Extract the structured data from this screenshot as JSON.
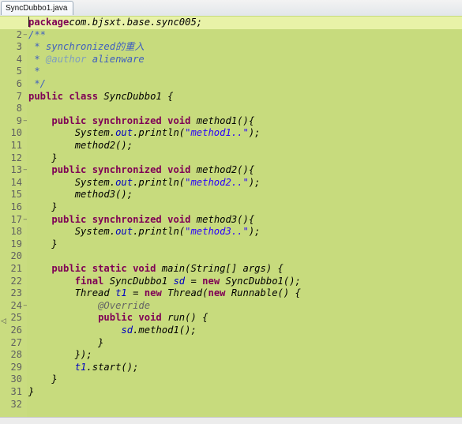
{
  "tab": {
    "title": "SyncDubbo1.java"
  },
  "line_numbers": [
    "1",
    "2",
    "3",
    "4",
    "5",
    "6",
    "7",
    "8",
    "9",
    "10",
    "11",
    "12",
    "13",
    "14",
    "15",
    "16",
    "17",
    "18",
    "19",
    "20",
    "21",
    "22",
    "23",
    "24",
    "25",
    "26",
    "27",
    "28",
    "29",
    "30",
    "31",
    "32"
  ],
  "fold_markers": {
    "2": "−",
    "9": "−",
    "13": "−",
    "17": "−",
    "24": "−"
  },
  "gutter_marker": "◁",
  "code_lines": [
    [
      [
        "kw",
        "package"
      ],
      [
        "",
        "com.bjsxt.base.sync005;"
      ]
    ],
    [
      [
        "cm",
        "/**"
      ]
    ],
    [
      [
        "cm",
        " * synchronized的重入"
      ]
    ],
    [
      [
        "cm",
        " * "
      ],
      [
        "tag",
        "@author"
      ],
      [
        "cm",
        " alienware"
      ]
    ],
    [
      [
        "cm",
        " *"
      ]
    ],
    [
      [
        "cm",
        " */"
      ]
    ],
    [
      [
        "kw",
        "public class"
      ],
      [
        "",
        " SyncDubbo1 {"
      ]
    ],
    [
      [
        "",
        ""
      ]
    ],
    [
      [
        "",
        "    "
      ],
      [
        "kw",
        "public synchronized void"
      ],
      [
        "",
        " method1(){"
      ]
    ],
    [
      [
        "",
        "        System."
      ],
      [
        "fld",
        "out"
      ],
      [
        "",
        ".println("
      ],
      [
        "str",
        "\"method1..\""
      ],
      [
        "",
        ");"
      ]
    ],
    [
      [
        "",
        "        method2();"
      ]
    ],
    [
      [
        "",
        "    }"
      ]
    ],
    [
      [
        "",
        "    "
      ],
      [
        "kw",
        "public synchronized void"
      ],
      [
        "",
        " method2(){"
      ]
    ],
    [
      [
        "",
        "        System."
      ],
      [
        "fld",
        "out"
      ],
      [
        "",
        ".println("
      ],
      [
        "str",
        "\"method2..\""
      ],
      [
        "",
        ");"
      ]
    ],
    [
      [
        "",
        "        method3();"
      ]
    ],
    [
      [
        "",
        "    }"
      ]
    ],
    [
      [
        "",
        "    "
      ],
      [
        "kw",
        "public synchronized void"
      ],
      [
        "",
        " method3(){"
      ]
    ],
    [
      [
        "",
        "        System."
      ],
      [
        "fld",
        "out"
      ],
      [
        "",
        ".println("
      ],
      [
        "str",
        "\"method3..\""
      ],
      [
        "",
        ");"
      ]
    ],
    [
      [
        "",
        "    }"
      ]
    ],
    [
      [
        "",
        ""
      ]
    ],
    [
      [
        "",
        "    "
      ],
      [
        "kw",
        "public static void"
      ],
      [
        "",
        " main(String[] args) {"
      ]
    ],
    [
      [
        "",
        "        "
      ],
      [
        "kw",
        "final"
      ],
      [
        "",
        " SyncDubbo1 "
      ],
      [
        "fld",
        "sd"
      ],
      [
        "",
        " = "
      ],
      [
        "kw",
        "new"
      ],
      [
        "",
        " SyncDubbo1();"
      ]
    ],
    [
      [
        "",
        "        Thread "
      ],
      [
        "fld",
        "t1"
      ],
      [
        "",
        " = "
      ],
      [
        "kw",
        "new"
      ],
      [
        "",
        " Thread("
      ],
      [
        "kw",
        "new"
      ],
      [
        "",
        " Runnable() {"
      ]
    ],
    [
      [
        "",
        "            "
      ],
      [
        "ann",
        "@Override"
      ]
    ],
    [
      [
        "",
        "            "
      ],
      [
        "kw",
        "public void"
      ],
      [
        "",
        " run() {"
      ]
    ],
    [
      [
        "",
        "                "
      ],
      [
        "fld",
        "sd"
      ],
      [
        "",
        ".method1();"
      ]
    ],
    [
      [
        "",
        "            }"
      ]
    ],
    [
      [
        "",
        "        });"
      ]
    ],
    [
      [
        "",
        "        "
      ],
      [
        "fld",
        "t1"
      ],
      [
        "",
        ".start();"
      ]
    ],
    [
      [
        "",
        "    }"
      ]
    ],
    [
      [
        "",
        "}"
      ]
    ],
    [
      [
        "",
        ""
      ]
    ]
  ]
}
